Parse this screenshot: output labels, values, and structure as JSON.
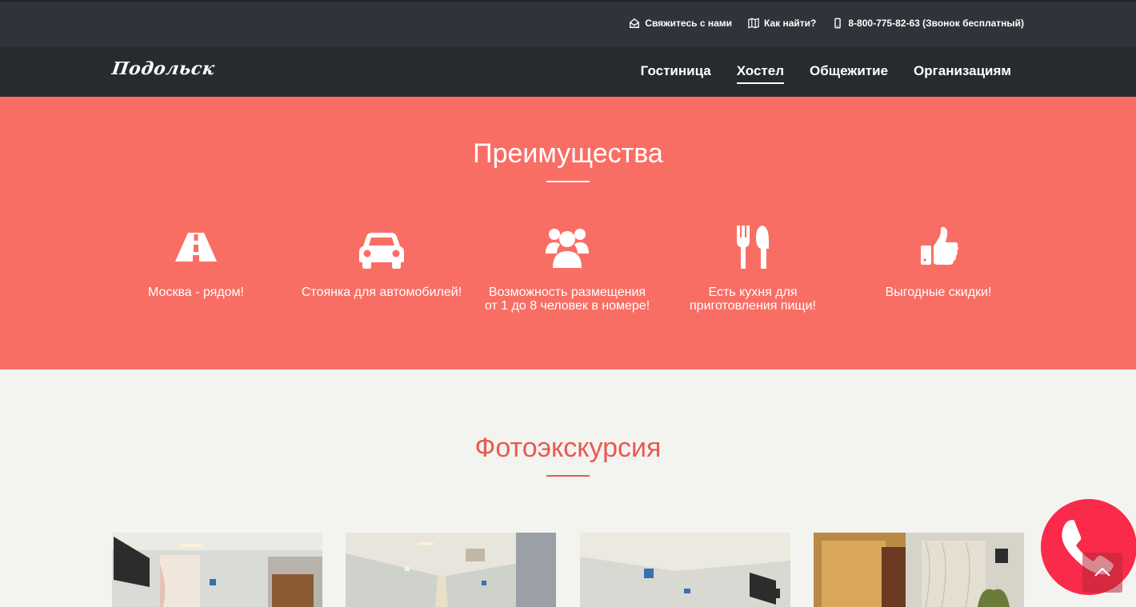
{
  "topbar": {
    "contact": "Свяжитесь с нами",
    "find": "Как найти?",
    "phone": "8-800-775-82-63 (Звонок бесплатный)",
    "icons": [
      "envelope-open-icon",
      "map-icon",
      "mobile-phone-icon"
    ]
  },
  "brand": {
    "logo": "Подольск"
  },
  "nav": {
    "items": [
      "Гостиница",
      "Хостел",
      "Общежитие",
      "Организациям"
    ],
    "active": "Хостел"
  },
  "advantages": {
    "title": "Преимущества",
    "items": [
      {
        "icon": "road-icon",
        "text": "Москва - рядом!"
      },
      {
        "icon": "car-icon",
        "text": "Стоянка для автомобилей!"
      },
      {
        "icon": "users-icon",
        "text": "Возможность размещения\nот 1 до 8 человек в номере!"
      },
      {
        "icon": "cutlery-icon",
        "text": "Есть кухня для\nприготовления пищи!"
      },
      {
        "icon": "thumbs-up-icon",
        "text": "Выгодные скидки!"
      }
    ]
  },
  "tour": {
    "title": "Фотоэкскурсия"
  },
  "colors": {
    "accent": "#f96e64",
    "accent_text": "#e85a52",
    "dark": "#272b2e",
    "topbar": "#30343a",
    "call": "#fa2b4a"
  }
}
